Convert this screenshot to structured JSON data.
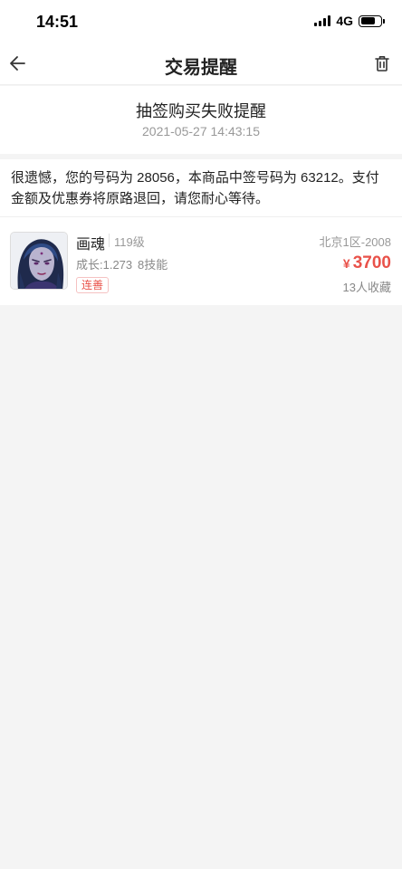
{
  "status_bar": {
    "time": "14:51",
    "network": "4G",
    "signal_icon": "signal-bars-icon",
    "battery_icon": "battery-icon",
    "battery_level": 0.75
  },
  "nav": {
    "title": "交易提醒",
    "back_icon": "arrow-left-icon",
    "delete_icon": "trash-icon"
  },
  "notice": {
    "subject": "抽签购买失败提醒",
    "datetime": "2021-05-27 14:43:15",
    "message": "很遗憾，您的号码为 28056，本商品中签号码为 63212。支付金额及优惠券将原路退回，请您耐心等待。"
  },
  "item": {
    "name": "画魂",
    "level": "119级",
    "growth": "成长:1.273",
    "skills": "8技能",
    "badge": "连善",
    "server": "北京1区-2008",
    "currency": "¥",
    "price": "3700",
    "favorites": "13人收藏"
  },
  "colors": {
    "accent": "#e9524a",
    "background": "#f4f4f4",
    "card": "#ffffff",
    "muted": "#999999"
  }
}
